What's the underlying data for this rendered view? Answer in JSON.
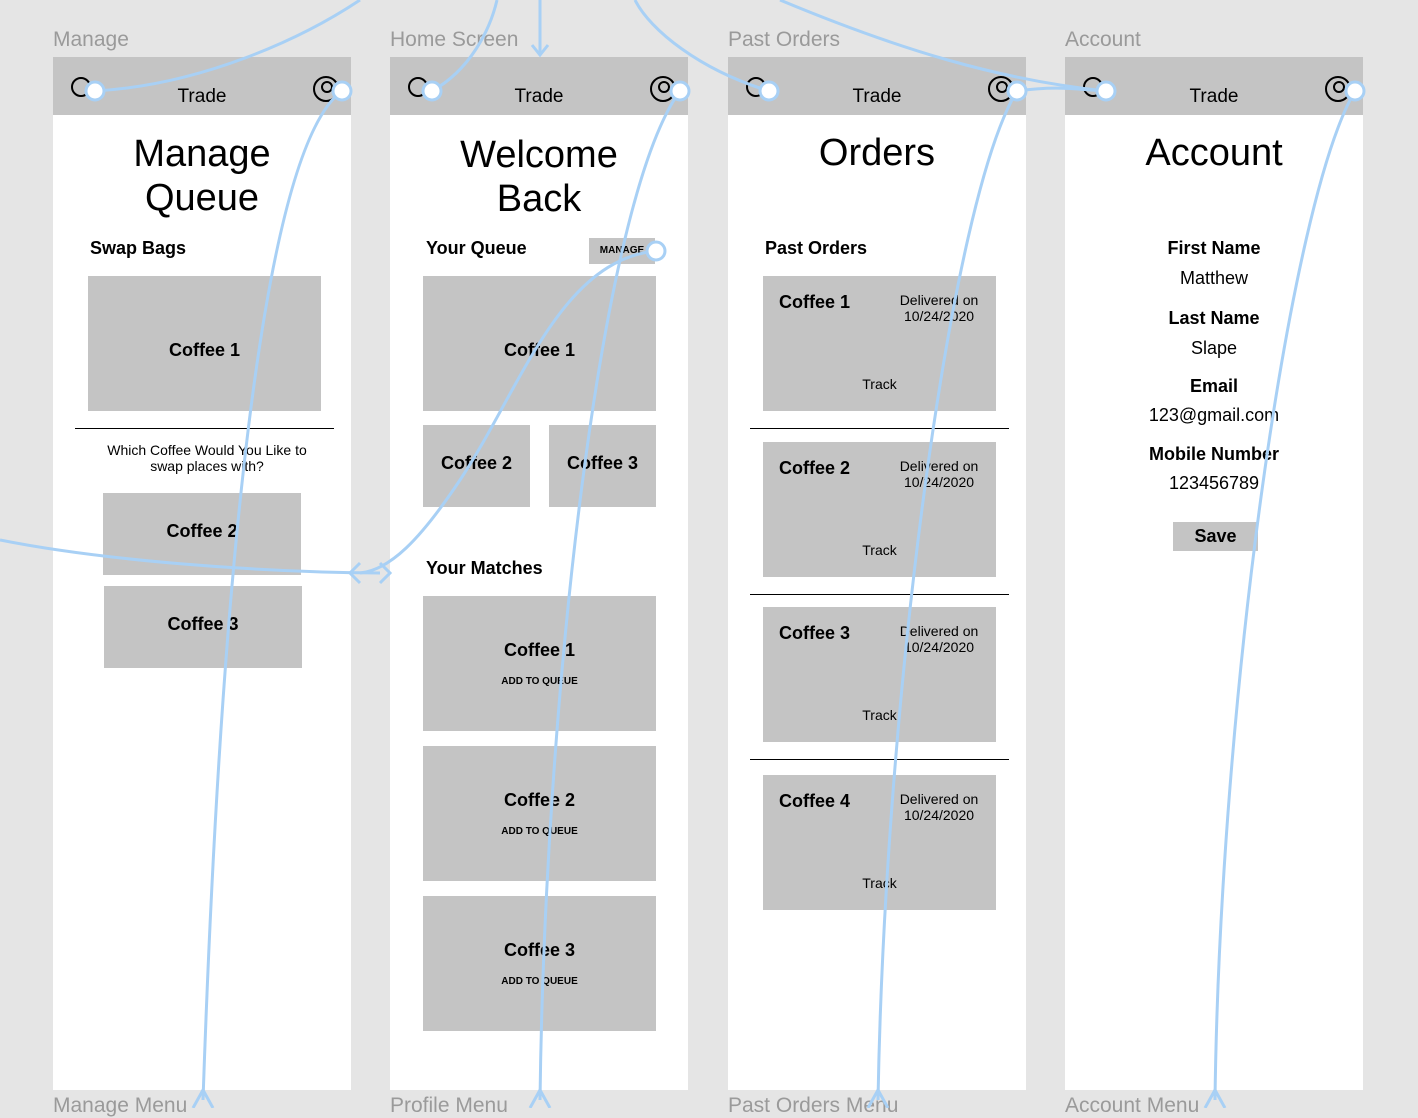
{
  "frames": [
    {
      "label": "Manage",
      "menu_label": "Manage Menu",
      "header": "Trade",
      "title_l1": "Manage",
      "title_l2": "Queue",
      "section": "Swap Bags",
      "current": "Coffee 1",
      "prompt": "Which Coffee Would You Like to swap places with?",
      "options": [
        "Coffee 2",
        "Coffee 3"
      ]
    },
    {
      "label": "Home Screen",
      "menu_label": "Profile Menu",
      "header": "Trade",
      "title_l1": "Welcome",
      "title_l2": "Back",
      "queue_title": "Your Queue",
      "manage_button": "MANAGE",
      "queue": [
        "Coffee 1",
        "Coffee 2",
        "Coffee 3"
      ],
      "matches_title": "Your Matches",
      "matches": [
        {
          "name": "Coffee 1",
          "action": "ADD TO QUEUE"
        },
        {
          "name": "Coffee 2",
          "action": "ADD TO QUEUE"
        },
        {
          "name": "Coffee 3",
          "action": "ADD TO QUEUE"
        }
      ]
    },
    {
      "label": "Past Orders",
      "menu_label": "Past Orders Menu",
      "header": "Trade",
      "title": "Orders",
      "section": "Past Orders",
      "orders": [
        {
          "name": "Coffee 1",
          "status": "Delivered on",
          "date": "10/24/2020",
          "track": "Track"
        },
        {
          "name": "Coffee 2",
          "status": "Delivered on",
          "date": "10/24/2020",
          "track": "Track"
        },
        {
          "name": "Coffee 3",
          "status": "Delivered on",
          "date": "10/24/2020",
          "track": "Track"
        },
        {
          "name": "Coffee 4",
          "status": "Delivered on",
          "date": "10/24/2020",
          "track": "Track"
        }
      ]
    },
    {
      "label": "Account",
      "menu_label": "Account Menu",
      "header": "Trade",
      "title": "Account",
      "fields": [
        {
          "label": "First Name",
          "value": "Matthew"
        },
        {
          "label": "Last Name",
          "value": "Slape"
        },
        {
          "label": "Email",
          "value": "123@gmail.com"
        },
        {
          "label": "Mobile Number",
          "value": "123456789"
        }
      ],
      "save": "Save"
    }
  ],
  "colors": {
    "background": "#e5e5e5",
    "header": "#c4c4c4",
    "connector": "#a8d0f5"
  }
}
